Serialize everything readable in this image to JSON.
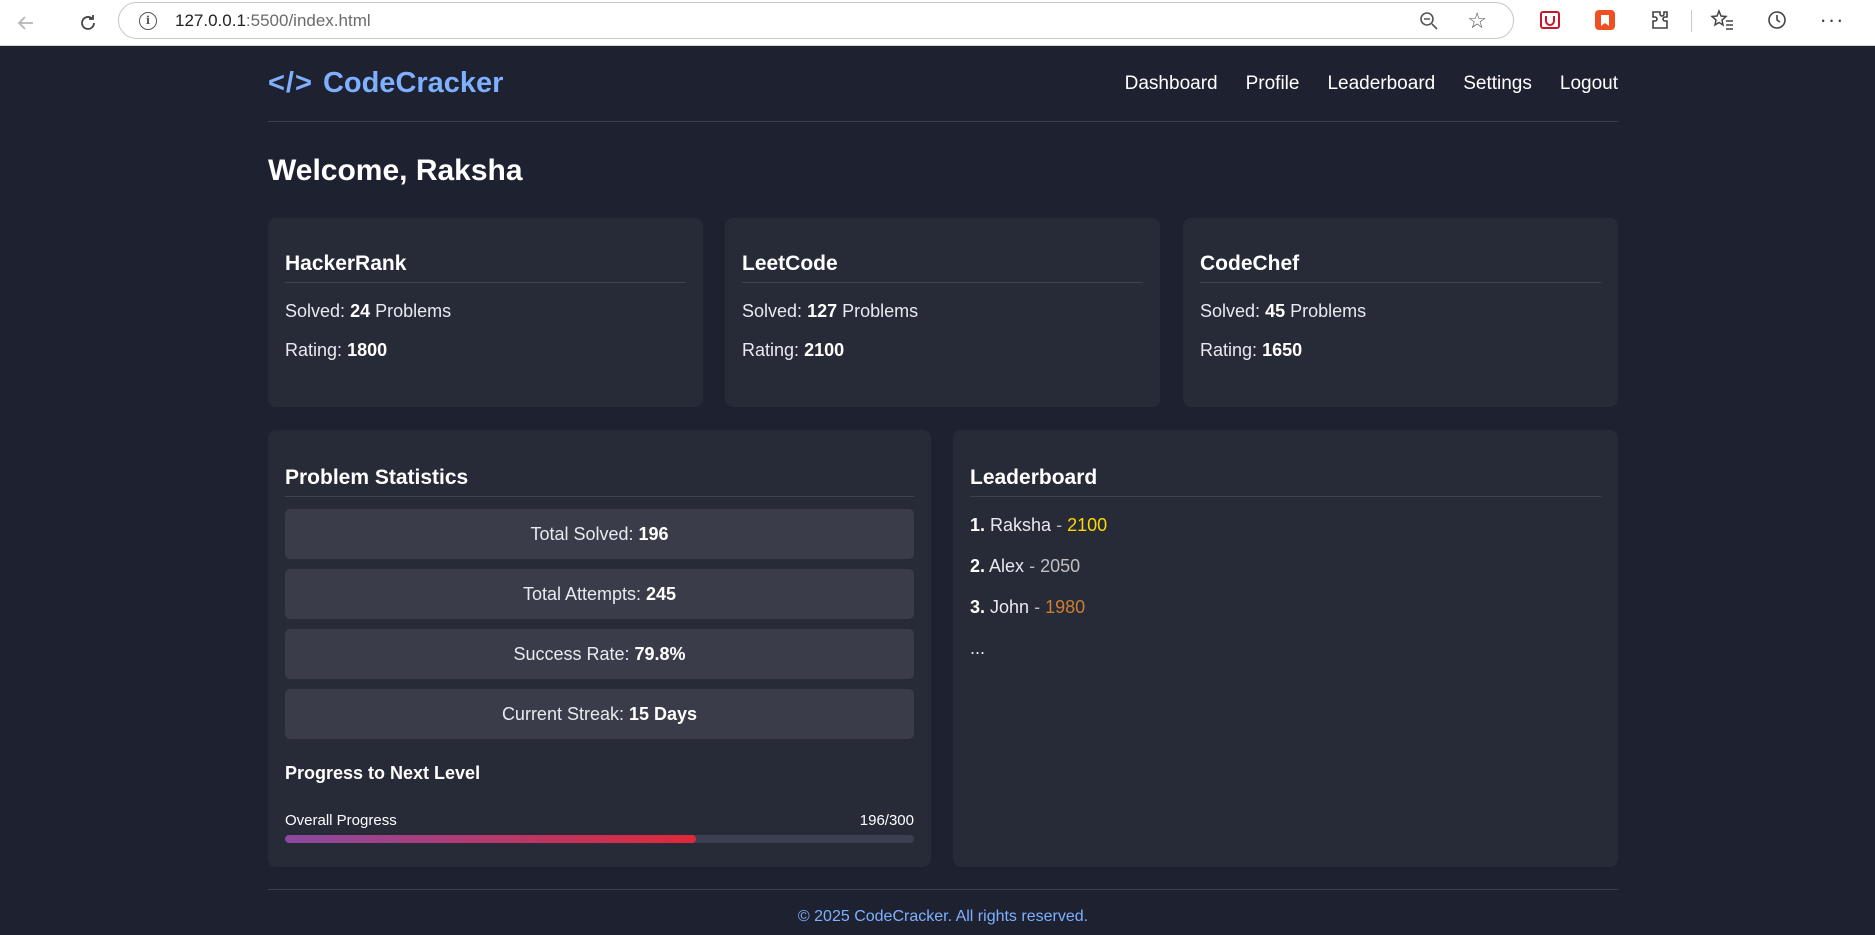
{
  "browser": {
    "url_host": "127.0.0.1",
    "url_rest": ":5500/index.html"
  },
  "header": {
    "logo_symbol": "</>",
    "logo_text": "CodeCracker",
    "nav": [
      "Dashboard",
      "Profile",
      "Leaderboard",
      "Settings",
      "Logout"
    ]
  },
  "welcome": "Welcome, Raksha",
  "platforms": [
    {
      "name": "HackerRank",
      "solved_label": "Solved:",
      "solved": "24",
      "solved_suffix": "Problems",
      "rating_label": "Rating:",
      "rating": "1800"
    },
    {
      "name": "LeetCode",
      "solved_label": "Solved:",
      "solved": "127",
      "solved_suffix": "Problems",
      "rating_label": "Rating:",
      "rating": "2100"
    },
    {
      "name": "CodeChef",
      "solved_label": "Solved:",
      "solved": "45",
      "solved_suffix": "Problems",
      "rating_label": "Rating:",
      "rating": "1650"
    }
  ],
  "stats": {
    "title": "Problem Statistics",
    "items": [
      {
        "label": "Total Solved:",
        "value": "196"
      },
      {
        "label": "Total Attempts:",
        "value": "245"
      },
      {
        "label": "Success Rate:",
        "value": "79.8%"
      },
      {
        "label": "Current Streak:",
        "value": "15 Days"
      }
    ],
    "progress_title": "Progress to Next Level",
    "progress_label": "Overall Progress",
    "progress_text": "196/300",
    "progress_fraction": 0.653
  },
  "leaderboard": {
    "title": "Leaderboard",
    "entries": [
      {
        "rank": "1.",
        "name": "Raksha",
        "score": "2100",
        "color": "#ffd700"
      },
      {
        "rank": "2.",
        "name": "Alex",
        "score": "2050",
        "color": "#c0c0c0"
      },
      {
        "rank": "3.",
        "name": "John",
        "score": "1980",
        "color": "#cd7f32"
      }
    ],
    "more": "..."
  },
  "footer": "© 2025 CodeCracker. All rights reserved.",
  "colors": {
    "background": "#1e2130",
    "card": "#272a37",
    "accent": "#7fb0ff",
    "progress_start": "#8a4aa0",
    "progress_end": "#e0283a"
  }
}
